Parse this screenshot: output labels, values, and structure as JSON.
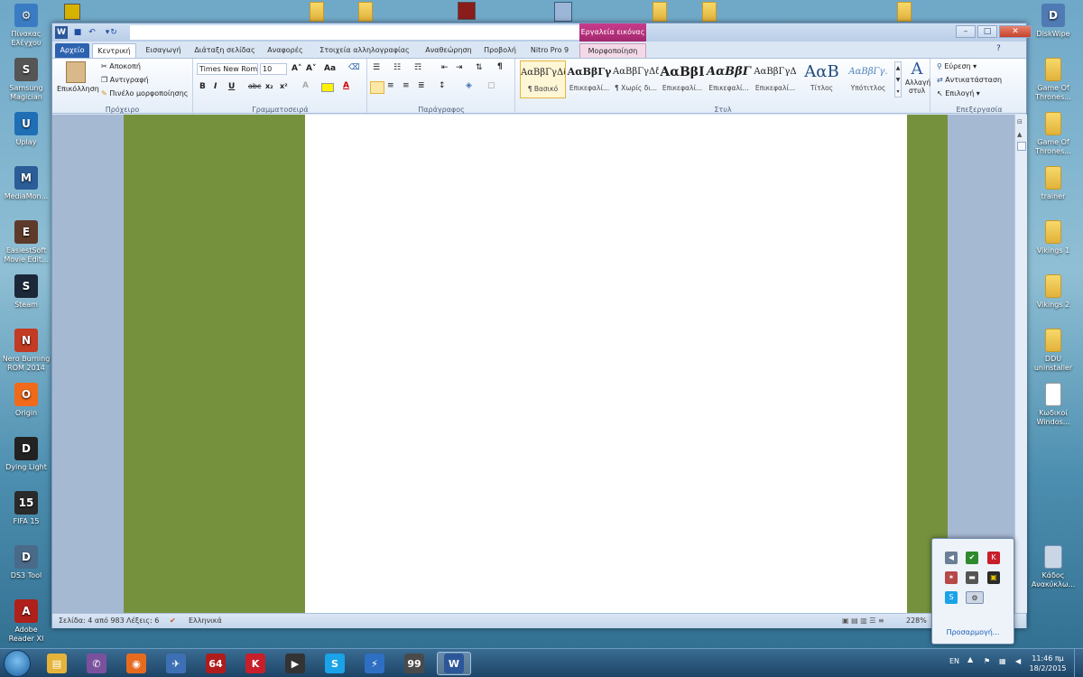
{
  "desktop_left": [
    {
      "label": "Πίνακας\nΕλέγχου",
      "color": "#3a7cc4",
      "glyph": "⚙",
      "icon": "control-panel-icon"
    },
    {
      "label": "Samsung\nMagician",
      "color": "#555",
      "glyph": "S",
      "icon": "samsung-magician-icon"
    },
    {
      "label": "Uplay",
      "color": "#1f6fb5",
      "glyph": "U",
      "icon": "uplay-icon"
    },
    {
      "label": "MediaMon...",
      "color": "#2b5d97",
      "glyph": "M",
      "icon": "mediamonkey-icon"
    },
    {
      "label": "EasiestSoft\nMovie Edit...",
      "color": "#5e3a2a",
      "glyph": "E",
      "icon": "easiestsoft-icon"
    },
    {
      "label": "Steam",
      "color": "#1b2838",
      "glyph": "S",
      "icon": "steam-icon"
    },
    {
      "label": "Nero Burning\nROM 2014",
      "color": "#c23b22",
      "glyph": "N",
      "icon": "nero-icon"
    },
    {
      "label": "Origin",
      "color": "#f06a1a",
      "glyph": "O",
      "icon": "origin-icon"
    },
    {
      "label": "Dying Light",
      "color": "#222",
      "glyph": "D",
      "icon": "dying-light-icon"
    },
    {
      "label": "FIFA 15",
      "color": "#2a2a2a",
      "glyph": "15",
      "icon": "fifa-icon"
    },
    {
      "label": "DS3 Tool",
      "color": "#4a6a8a",
      "glyph": "D",
      "icon": "ds3-tool-icon"
    },
    {
      "label": "Adobe\nReader XI",
      "color": "#b0201a",
      "glyph": "A",
      "icon": "adobe-reader-icon"
    }
  ],
  "desktop_right": [
    {
      "label": "DiskWipe",
      "color": "#4f7ab3",
      "glyph": "D",
      "icon": "diskwipe-icon",
      "type": "app"
    },
    {
      "label": "Game Of\nThrones...",
      "type": "folder",
      "icon": "folder-icon"
    },
    {
      "label": "Game Of\nThrones...",
      "type": "folder",
      "icon": "folder-icon"
    },
    {
      "label": "trainer",
      "type": "folder",
      "icon": "folder-icon"
    },
    {
      "label": "Vikings 1",
      "type": "folder",
      "icon": "folder-icon"
    },
    {
      "label": "Vikings 2",
      "type": "folder",
      "icon": "folder-icon"
    },
    {
      "label": "DDU\nuninstaller",
      "type": "folder",
      "icon": "folder-icon"
    },
    {
      "label": "Κωδικοί\nWindos...",
      "type": "file",
      "icon": "text-file-icon"
    },
    {
      "label": "Κάδος\nΑνακύκλω...",
      "type": "bin",
      "icon": "recycle-bin-icon"
    }
  ],
  "titlebar": {
    "context_tab": "Εργαλεία εικόνας",
    "min": "–",
    "max": "□",
    "close": "✕"
  },
  "tabs": [
    "Αρχείο",
    "Κεντρική",
    "Εισαγωγή",
    "Διάταξη σελίδας",
    "Αναφορές",
    "Στοιχεία αλληλογραφίας",
    "Αναθεώρηση",
    "Προβολή",
    "Nitro Pro 9",
    "Μορφοποίηση"
  ],
  "ribbon": {
    "clipboard": {
      "paste": "Επικόλληση",
      "cut": "Αποκοπή",
      "copy": "Αντιγραφή",
      "painter": "Πινέλο μορφοποίησης",
      "label": "Πρόχειρο"
    },
    "font": {
      "name": "Times New Rom",
      "size": "10",
      "label": "Γραμματοσειρά",
      "bold": "B",
      "italic": "I",
      "underline": "U",
      "strike": "abc",
      "sub": "x₂",
      "sup": "x²",
      "grow": "A˄",
      "shrink": "A˅",
      "case": "Aa",
      "color": "A"
    },
    "paragraph": {
      "label": "Παράγραφος",
      "pilcrow": "¶"
    },
    "styles": {
      "label": "Στυλ",
      "items": [
        {
          "sample": "ΑαΒβΓγΔδ",
          "name": "¶ Βασικό"
        },
        {
          "sample": "ΑαΒβΓγ",
          "name": "Επικεφαλί..."
        },
        {
          "sample": "ΑαΒβΓγΔδ",
          "name": "¶ Χωρίς δι..."
        },
        {
          "sample": "ΑαΒβΙ",
          "name": "Επικεφαλί..."
        },
        {
          "sample": "ΑαΒβΓ",
          "name": "Επικεφαλί..."
        },
        {
          "sample": "ΑαΒβΓγΔ",
          "name": "Επικεφαλί..."
        },
        {
          "sample": "ΑαΒ",
          "name": "Τίτλος"
        },
        {
          "sample": "ΑαΒβΓγ.",
          "name": "Υπότιτλος"
        }
      ],
      "change": "Αλλαγή\nστυλ"
    },
    "editing": {
      "label": "Επεξεργασία",
      "find": "Εύρεση",
      "replace": "Αντικατάσταση",
      "select": "Επιλογή"
    }
  },
  "status": {
    "page": "Σελίδα: 4 από 983",
    "words": "Λέξεις: 6",
    "lang": "Ελληνικά",
    "zoom": "228%"
  },
  "tray_popup": {
    "customize": "Προσαρμογή..."
  },
  "taskbar": {
    "lang": "EN",
    "time": "11:46 πμ",
    "date": "18/2/2015"
  },
  "taskbar_apps": [
    {
      "name": "explorer",
      "glyph": "▤",
      "color": "#e5b33a"
    },
    {
      "name": "viber",
      "glyph": "✆",
      "color": "#7b519d"
    },
    {
      "name": "firefox",
      "glyph": "◉",
      "color": "#e76b1f"
    },
    {
      "name": "app-plane",
      "glyph": "✈",
      "color": "#3d6fb5"
    },
    {
      "name": "aida64",
      "glyph": "64",
      "color": "#b01c1c"
    },
    {
      "name": "kaspersky",
      "glyph": "K",
      "color": "#c81f2a"
    },
    {
      "name": "video-editor",
      "glyph": "▶",
      "color": "#333"
    },
    {
      "name": "skype",
      "glyph": "S",
      "color": "#1aa3e8"
    },
    {
      "name": "power-app",
      "glyph": "⚡",
      "color": "#2e6fc4"
    },
    {
      "name": "monitor-app",
      "glyph": "99",
      "color": "#4a4a4a"
    },
    {
      "name": "word",
      "glyph": "W",
      "color": "#2b579a"
    }
  ]
}
